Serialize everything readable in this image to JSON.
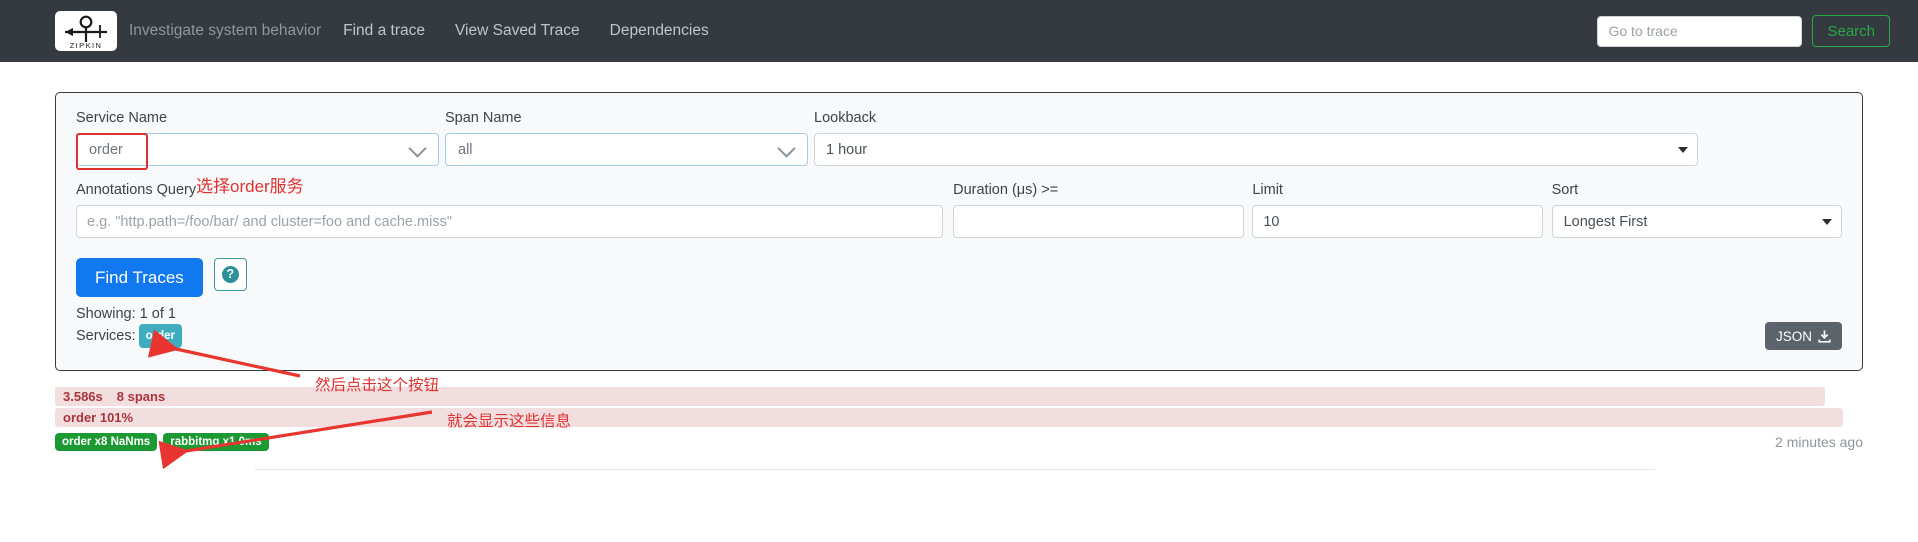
{
  "navbar": {
    "logo_text": "ZIPKIN",
    "logo_name": "zipkin-logo",
    "tagline": "Investigate system behavior",
    "links": [
      {
        "label": "Find a trace",
        "name": "nav-link-find-a-trace"
      },
      {
        "label": "View Saved Trace",
        "name": "nav-link-view-saved-trace"
      },
      {
        "label": "Dependencies",
        "name": "nav-link-dependencies"
      }
    ],
    "trace_input_placeholder": "Go to trace",
    "trace_input_value": "",
    "search_button": "Search"
  },
  "search_panel": {
    "service_name": {
      "label": "Service Name",
      "value": "order",
      "icon": "chevron-down-icon"
    },
    "span_name": {
      "label": "Span Name",
      "value": "all",
      "icon": "chevron-down-icon"
    },
    "lookback": {
      "label": "Lookback",
      "value": "1 hour",
      "icon": "caret-down-icon"
    },
    "annotations_query": {
      "label": "Annotations Query",
      "value": "",
      "placeholder": "e.g. \"http.path=/foo/bar/ and cluster=foo and cache.miss\""
    },
    "duration": {
      "label": "Duration (μs) >=",
      "value": "",
      "placeholder": ""
    },
    "limit": {
      "label": "Limit",
      "value": "10",
      "placeholder": ""
    },
    "sort": {
      "label": "Sort",
      "value": "Longest First",
      "icon": "caret-down-icon"
    },
    "find_traces_button": "Find Traces",
    "help_button_icon": "question-mark-icon",
    "showing_label": "Showing: 1 of 1",
    "services_label": "Services:",
    "services_chips": [
      "order"
    ],
    "json_button": "JSON",
    "json_button_icon": "download-icon"
  },
  "results": [
    {
      "duration": "3.586s",
      "spans": "8 spans",
      "service_percent": "order 101%",
      "chips": [
        "order x8 NaNms",
        "rabbitmq x1 0ms"
      ],
      "timestamp": "2 minutes ago"
    }
  ],
  "annotations": [
    {
      "text": "选择order服务",
      "name": "annotation-select-order-service"
    },
    {
      "text": "然后点击这个按钮",
      "name": "annotation-click-this-button"
    },
    {
      "text": "就会显示这些信息",
      "name": "annotation-shows-this-info"
    }
  ],
  "colors": {
    "navbar_bg": "#343a40",
    "primary_button": "#1178f0",
    "search_button": "#28a745",
    "annotation_red": "#e03131",
    "service_chip": "#3fadbd",
    "span_chip": "#1b9a34",
    "trace_bar": "#f3dedf",
    "trace_bar_text": "#a8353b"
  }
}
